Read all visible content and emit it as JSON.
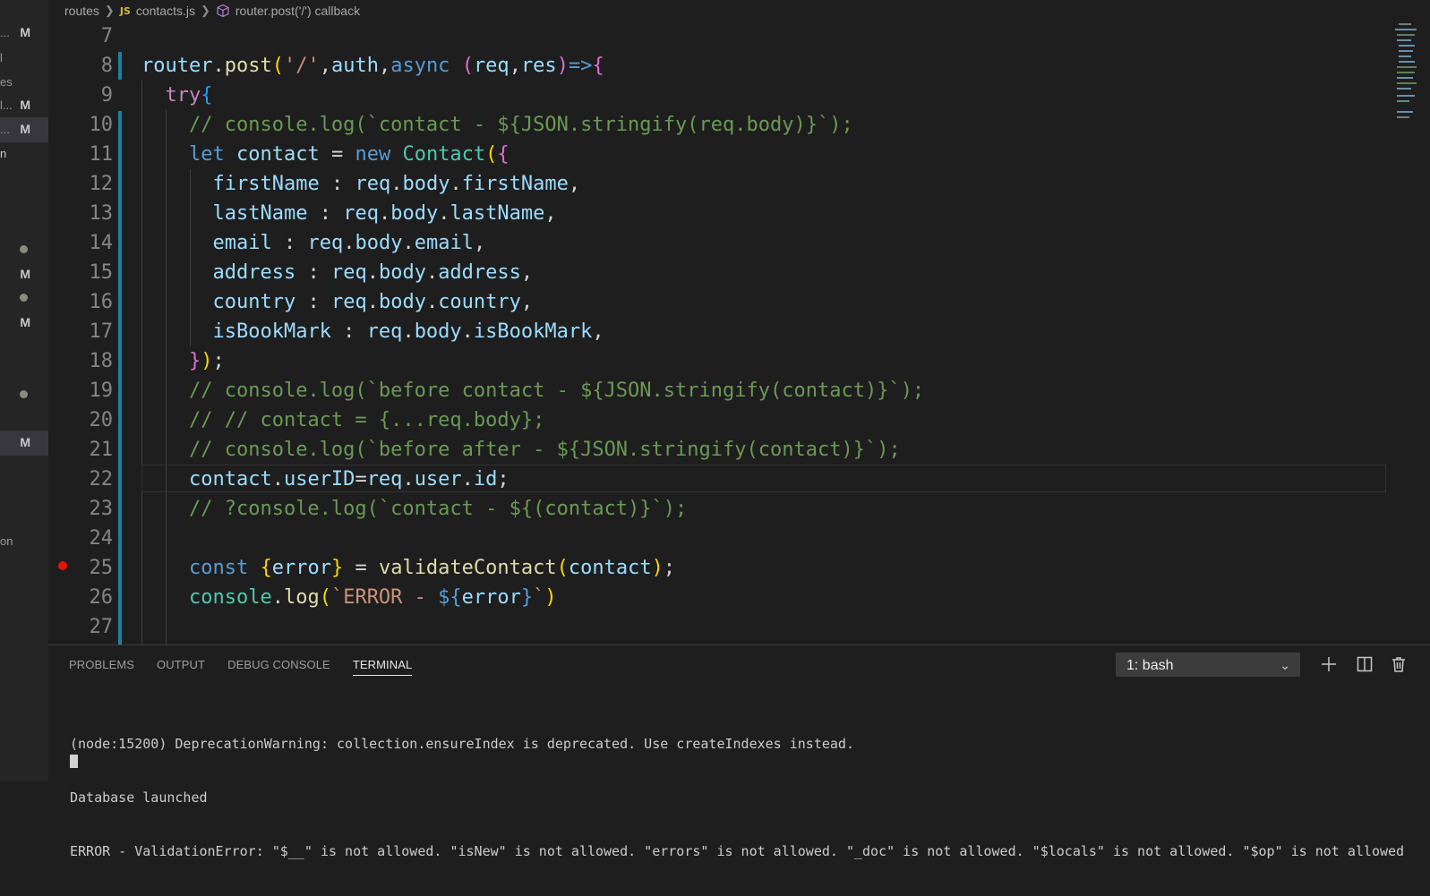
{
  "breadcrumb": {
    "folder": "routes",
    "file_badge": "JS",
    "file": "contacts.js",
    "symbol": "router.post('/') callback"
  },
  "sidebar": {
    "rows": [
      {
        "frag": "...",
        "badge": "M"
      },
      {
        "frag": "l",
        "badge": ""
      },
      {
        "frag": "es",
        "badge": ""
      },
      {
        "frag": "l...",
        "badge": "M"
      },
      {
        "frag": "...",
        "badge": "M"
      },
      {
        "frag": "n",
        "badge": ""
      },
      {
        "frag": "",
        "badge": "M"
      },
      {
        "frag": "",
        "badge": "M"
      },
      {
        "frag": "",
        "badge": "M"
      },
      {
        "frag": "on",
        "badge": ""
      }
    ]
  },
  "editor": {
    "lines": [
      {
        "n": "7",
        "tokens": []
      },
      {
        "n": "8",
        "tokens": [
          [
            "t-var",
            "router"
          ],
          [
            "t-pl",
            "."
          ],
          [
            "t-fn",
            "post"
          ],
          [
            "b1",
            "("
          ],
          [
            "t-str",
            "'/'"
          ],
          [
            "t-pl",
            ","
          ],
          [
            "t-var",
            "auth"
          ],
          [
            "t-pl",
            ","
          ],
          [
            "t-kw",
            "async"
          ],
          [
            "t-pl",
            " "
          ],
          [
            "b2",
            "("
          ],
          [
            "t-var",
            "req"
          ],
          [
            "t-pl",
            ","
          ],
          [
            "t-var",
            "res"
          ],
          [
            "b2",
            ")"
          ],
          [
            "t-kw",
            "=>"
          ],
          [
            "b2",
            "{"
          ]
        ]
      },
      {
        "n": "9",
        "tokens": [
          [
            "t-pl",
            "  "
          ],
          [
            "t-ctl",
            "try"
          ],
          [
            "b3",
            "{"
          ]
        ]
      },
      {
        "n": "10",
        "tokens": [
          [
            "t-pl",
            "    "
          ],
          [
            "t-com",
            "// console.log(`contact - ${JSON.stringify(req.body)}`);"
          ]
        ]
      },
      {
        "n": "11",
        "tokens": [
          [
            "t-pl",
            "    "
          ],
          [
            "t-kw",
            "let"
          ],
          [
            "t-pl",
            " "
          ],
          [
            "t-var",
            "contact"
          ],
          [
            "t-pl",
            " = "
          ],
          [
            "t-kw",
            "new"
          ],
          [
            "t-pl",
            " "
          ],
          [
            "t-cls",
            "Contact"
          ],
          [
            "b1",
            "("
          ],
          [
            "b2",
            "{"
          ]
        ]
      },
      {
        "n": "12",
        "tokens": [
          [
            "t-pl",
            "      "
          ],
          [
            "t-var",
            "firstName"
          ],
          [
            "t-pl",
            " : "
          ],
          [
            "t-var",
            "req"
          ],
          [
            "t-pl",
            "."
          ],
          [
            "t-var",
            "body"
          ],
          [
            "t-pl",
            "."
          ],
          [
            "t-var",
            "firstName"
          ],
          [
            "t-pl",
            ","
          ]
        ]
      },
      {
        "n": "13",
        "tokens": [
          [
            "t-pl",
            "      "
          ],
          [
            "t-var",
            "lastName"
          ],
          [
            "t-pl",
            " : "
          ],
          [
            "t-var",
            "req"
          ],
          [
            "t-pl",
            "."
          ],
          [
            "t-var",
            "body"
          ],
          [
            "t-pl",
            "."
          ],
          [
            "t-var",
            "lastName"
          ],
          [
            "t-pl",
            ","
          ]
        ]
      },
      {
        "n": "14",
        "tokens": [
          [
            "t-pl",
            "      "
          ],
          [
            "t-var",
            "email"
          ],
          [
            "t-pl",
            " : "
          ],
          [
            "t-var",
            "req"
          ],
          [
            "t-pl",
            "."
          ],
          [
            "t-var",
            "body"
          ],
          [
            "t-pl",
            "."
          ],
          [
            "t-var",
            "email"
          ],
          [
            "t-pl",
            ","
          ]
        ]
      },
      {
        "n": "15",
        "tokens": [
          [
            "t-pl",
            "      "
          ],
          [
            "t-var",
            "address"
          ],
          [
            "t-pl",
            " : "
          ],
          [
            "t-var",
            "req"
          ],
          [
            "t-pl",
            "."
          ],
          [
            "t-var",
            "body"
          ],
          [
            "t-pl",
            "."
          ],
          [
            "t-var",
            "address"
          ],
          [
            "t-pl",
            ","
          ]
        ]
      },
      {
        "n": "16",
        "tokens": [
          [
            "t-pl",
            "      "
          ],
          [
            "t-var",
            "country"
          ],
          [
            "t-pl",
            " : "
          ],
          [
            "t-var",
            "req"
          ],
          [
            "t-pl",
            "."
          ],
          [
            "t-var",
            "body"
          ],
          [
            "t-pl",
            "."
          ],
          [
            "t-var",
            "country"
          ],
          [
            "t-pl",
            ","
          ]
        ]
      },
      {
        "n": "17",
        "tokens": [
          [
            "t-pl",
            "      "
          ],
          [
            "t-var",
            "isBookMark"
          ],
          [
            "t-pl",
            " : "
          ],
          [
            "t-var",
            "req"
          ],
          [
            "t-pl",
            "."
          ],
          [
            "t-var",
            "body"
          ],
          [
            "t-pl",
            "."
          ],
          [
            "t-var",
            "isBookMark"
          ],
          [
            "t-pl",
            ","
          ]
        ]
      },
      {
        "n": "18",
        "tokens": [
          [
            "t-pl",
            "    "
          ],
          [
            "b2",
            "}"
          ],
          [
            "b1",
            ")"
          ],
          [
            "t-pl",
            ";"
          ]
        ]
      },
      {
        "n": "19",
        "tokens": [
          [
            "t-pl",
            "    "
          ],
          [
            "t-com",
            "// console.log(`before contact - ${JSON.stringify(contact)}`);"
          ]
        ]
      },
      {
        "n": "20",
        "tokens": [
          [
            "t-pl",
            "    "
          ],
          [
            "t-com",
            "// // contact = {...req.body};"
          ]
        ]
      },
      {
        "n": "21",
        "tokens": [
          [
            "t-pl",
            "    "
          ],
          [
            "t-com",
            "// console.log(`before after - ${JSON.stringify(contact)}`);"
          ]
        ]
      },
      {
        "n": "22",
        "tokens": [
          [
            "t-pl",
            "    "
          ],
          [
            "t-var",
            "contact"
          ],
          [
            "t-pl",
            "."
          ],
          [
            "t-var",
            "userID"
          ],
          [
            "t-pl",
            "="
          ],
          [
            "t-var",
            "req"
          ],
          [
            "t-pl",
            "."
          ],
          [
            "t-var",
            "user"
          ],
          [
            "t-pl",
            "."
          ],
          [
            "t-var",
            "id"
          ],
          [
            "t-pl",
            ";"
          ]
        ]
      },
      {
        "n": "23",
        "tokens": [
          [
            "t-pl",
            "    "
          ],
          [
            "t-com",
            "// ?console.log(`contact - ${(contact)}`);"
          ]
        ]
      },
      {
        "n": "24",
        "tokens": []
      },
      {
        "n": "25",
        "tokens": [
          [
            "t-pl",
            "    "
          ],
          [
            "t-kw",
            "const"
          ],
          [
            "t-pl",
            " "
          ],
          [
            "b1",
            "{"
          ],
          [
            "t-var",
            "error"
          ],
          [
            "b1",
            "}"
          ],
          [
            "t-pl",
            " = "
          ],
          [
            "t-fn",
            "validateContact"
          ],
          [
            "b1",
            "("
          ],
          [
            "t-var",
            "contact"
          ],
          [
            "b1",
            ")"
          ],
          [
            "t-pl",
            ";"
          ]
        ]
      },
      {
        "n": "26",
        "tokens": [
          [
            "t-pl",
            "    "
          ],
          [
            "t-cls",
            "console"
          ],
          [
            "t-pl",
            "."
          ],
          [
            "t-fn",
            "log"
          ],
          [
            "b1",
            "("
          ],
          [
            "t-str",
            "`ERROR - "
          ],
          [
            "t-kw",
            "${"
          ],
          [
            "t-var",
            "error"
          ],
          [
            "t-kw",
            "}"
          ],
          [
            "t-str",
            "`"
          ],
          [
            "b1",
            ")"
          ]
        ]
      },
      {
        "n": "27",
        "tokens": []
      }
    ]
  },
  "panel": {
    "tabs": [
      "PROBLEMS",
      "OUTPUT",
      "DEBUG CONSOLE",
      "TERMINAL"
    ],
    "active_tab": "TERMINAL",
    "terminal_select": "1: bash",
    "output": [
      "(node:15200) DeprecationWarning: collection.ensureIndex is deprecated. Use createIndexes instead.",
      "Database launched",
      "ERROR - ValidationError: \"$__\" is not allowed. \"isNew\" is not allowed. \"errors\" is not allowed. \"_doc\" is not allowed. \"$locals\" is not allowed. \"$op\" is not allowed"
    ]
  },
  "icons": {
    "breadcrumb_separator": "chevron-right-icon",
    "symbol": "method-cube-icon",
    "new_terminal": "plus-icon",
    "split_terminal": "split-icon",
    "kill_terminal": "trash-icon",
    "select_caret": "chevron-down-icon"
  },
  "colors": {
    "editor_bg": "#1e1e1e",
    "sidebar_bg": "#252526",
    "gutter_modified": "#1b81a8",
    "breakpoint": "#e51400"
  }
}
